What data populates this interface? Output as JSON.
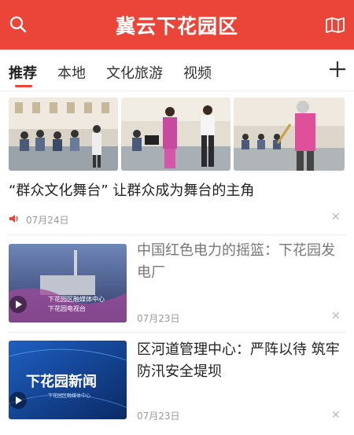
{
  "header": {
    "title": "冀云下花园区",
    "bg_color": "#ea4538"
  },
  "tabs": [
    "推荐",
    "本地",
    "文化旅游",
    "视频"
  ],
  "news": [
    {
      "title": "“群众文化舞台” 让群众成为舞台的主角",
      "date": "07月24日"
    },
    {
      "title": "中国红色电力的摇篮：下花园发电厂",
      "date": "07月23日",
      "thumb_caption": "下花园区融媒体中心 下花园电视台"
    },
    {
      "title": "区河道管理中心：严阵以待 筑牢防汛安全堤坝",
      "date": "07月23日",
      "thumb_caption": "下花园新闻",
      "thumb_subcaption": "下花园区融媒体中心"
    }
  ],
  "icons": [
    "search-icon",
    "map-icon",
    "plus-icon",
    "speaker-icon",
    "close-icon",
    "play-icon"
  ]
}
